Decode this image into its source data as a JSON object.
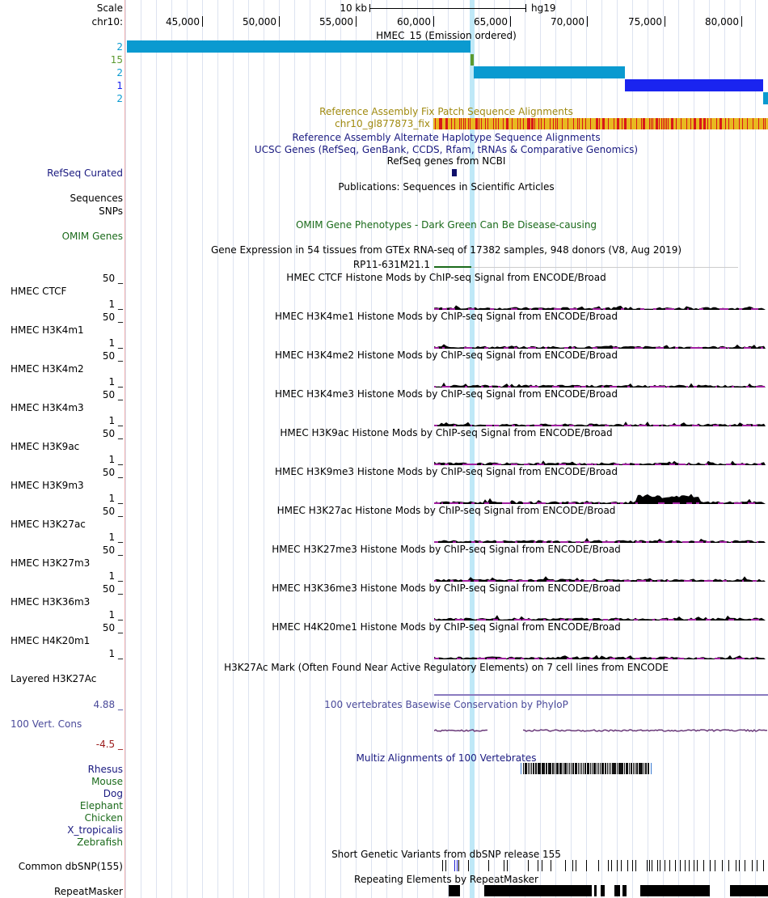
{
  "ruler": {
    "scale_label": "Scale",
    "chrom_label": "chr10:",
    "scale_bar_text": "10 kb",
    "assembly": "hg19",
    "ticks": [
      "45,000",
      "50,000",
      "55,000",
      "60,000",
      "65,000",
      "70,000",
      "75,000",
      "80,000"
    ]
  },
  "chromhmm": {
    "title": "HMEC_15 (Emission ordered)",
    "rows": [
      "2",
      "15",
      "2",
      "1",
      "2"
    ],
    "colors": [
      "#0a9ad0",
      "#5c9a30",
      "#0a9ad0",
      "#1a24f0",
      "#0a9ad0"
    ]
  },
  "fix_patch": {
    "title": "Reference Assembly Fix Patch Sequence Alignments",
    "item": "chr10_gl877873_fix"
  },
  "alt_haplo": {
    "title": "Reference Assembly Alternate Haplotype Sequence Alignments"
  },
  "ucsc_genes": {
    "title": "UCSC Genes (RefSeq, GenBank, CCDS, Rfam, tRNAs & Comparative Genomics)"
  },
  "refseq": {
    "title": "RefSeq genes from NCBI",
    "label": "RefSeq Curated"
  },
  "publications": {
    "title": "Publications: Sequences in Scientific Articles",
    "label1": "Sequences",
    "label2": "SNPs"
  },
  "omim": {
    "title": "OMIM Gene Phenotypes - Dark Green Can Be Disease-causing",
    "label": "OMIM Genes"
  },
  "gtex": {
    "title": "Gene Expression in 54 tissues from GTEx RNA-seq of 17382 samples, 948 donors (V8, Aug 2019)",
    "gene": "RP11-631M21.1"
  },
  "histone_tracks": [
    {
      "label": "HMEC CTCF",
      "title": "HMEC CTCF Histone Mods by ChIP-seq Signal from ENCODE/Broad",
      "max": "50 _",
      "min": "1 _"
    },
    {
      "label": "HMEC H3K4m1",
      "title": "HMEC H3K4me1 Histone Mods by ChIP-seq Signal from ENCODE/Broad",
      "max": "50 _",
      "min": "1 _"
    },
    {
      "label": "HMEC H3K4m2",
      "title": "HMEC H3K4me2 Histone Mods by ChIP-seq Signal from ENCODE/Broad",
      "max": "50 _",
      "min": "1 _"
    },
    {
      "label": "HMEC H3K4m3",
      "title": "HMEC H3K4me3 Histone Mods by ChIP-seq Signal from ENCODE/Broad",
      "max": "50 _",
      "min": "1 _"
    },
    {
      "label": "HMEC H3K9ac",
      "title": "HMEC H3K9ac Histone Mods by ChIP-seq Signal from ENCODE/Broad",
      "max": "50 _",
      "min": "1 _"
    },
    {
      "label": "HMEC H3K9m3",
      "title": "HMEC H3K9me3 Histone Mods by ChIP-seq Signal from ENCODE/Broad",
      "max": "50 _",
      "min": "1 _"
    },
    {
      "label": "HMEC H3K27ac",
      "title": "HMEC H3K27ac Histone Mods by ChIP-seq Signal from ENCODE/Broad",
      "max": "50 _",
      "min": "1 _"
    },
    {
      "label": "HMEC H3K27m3",
      "title": "HMEC H3K27me3 Histone Mods by ChIP-seq Signal from ENCODE/Broad",
      "max": "50 _",
      "min": "1 _"
    },
    {
      "label": "HMEC H3K36m3",
      "title": "HMEC H3K36me3 Histone Mods by ChIP-seq Signal from ENCODE/Broad",
      "max": "50 _",
      "min": "1 _"
    },
    {
      "label": "HMEC H4K20m1",
      "title": "HMEC H4K20me1 Histone Mods by ChIP-seq Signal from ENCODE/Broad",
      "max": "50 _",
      "min": "1 _"
    }
  ],
  "layered": {
    "title": "H3K27Ac Mark (Often Found Near Active Regulatory Elements) on 7 cell lines from ENCODE",
    "label": "Layered H3K27Ac"
  },
  "cons": {
    "title": "100 vertebrates Basewise Conservation by PhyloP",
    "label": "100 Vert. Cons",
    "max": "4.88 _",
    "min": "-4.5 _"
  },
  "multiz": {
    "title": "Multiz Alignments of 100 Vertebrates",
    "species": [
      "Rhesus",
      "Mouse",
      "Dog",
      "Elephant",
      "Chicken",
      "X_tropicalis",
      "Zebrafish"
    ],
    "species_colors": [
      "#1a1a80",
      "#1a6a1a",
      "#1a1a80",
      "#1a6a1a",
      "#1a6a1a",
      "#1a1a80",
      "#1a6a1a"
    ]
  },
  "dbsnp": {
    "title": "Short Genetic Variants from dbSNP release 155",
    "label": "Common dbSNP(155)"
  },
  "repeatmasker": {
    "title": "Repeating Elements by RepeatMasker",
    "label": "RepeatMasker"
  },
  "colors": {
    "navy_label": "#1a1a80",
    "green_label": "#1a6a1a",
    "fix_patch": "#a08a10",
    "fix_bar": "#e8b820",
    "fix_stripe": "#d81818",
    "histone_purple": "#a020a0",
    "cons_purple": "#4a4a9a",
    "cons_red": "#9a1a1a"
  }
}
